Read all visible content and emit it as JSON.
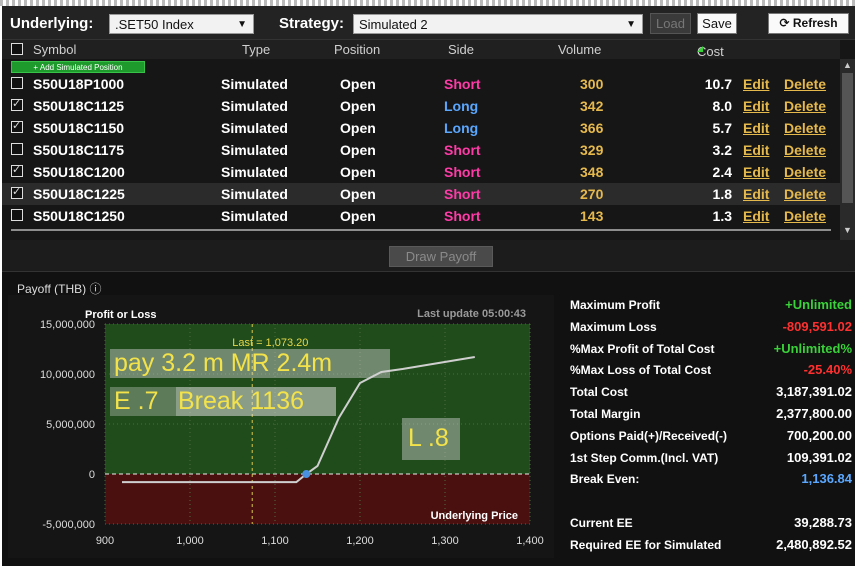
{
  "toolbar": {
    "underlying_label": "Underlying:",
    "underlying_value": ".SET50 Index",
    "strategy_label": "Strategy:",
    "strategy_value": "Simulated 2",
    "load_label": "Load",
    "save_label": "Save",
    "refresh_label": "Refresh",
    "refresh_icon": "refresh-icon"
  },
  "grid": {
    "headers": {
      "symbol": "Symbol",
      "type": "Type",
      "position": "Position",
      "side": "Side",
      "volume": "Volume",
      "cost": "Cost"
    },
    "add_label": "+ Add Simulated Position",
    "rows": [
      {
        "checked": false,
        "symbol": "S50U18P1000",
        "type": "Simulated",
        "position": "Open",
        "side": "Short",
        "volume": "300",
        "cost": "10.7",
        "edit": "Edit",
        "delete": "Delete"
      },
      {
        "checked": true,
        "symbol": "S50U18C1125",
        "type": "Simulated",
        "position": "Open",
        "side": "Long",
        "volume": "342",
        "cost": "8.0",
        "edit": "Edit",
        "delete": "Delete"
      },
      {
        "checked": true,
        "symbol": "S50U18C1150",
        "type": "Simulated",
        "position": "Open",
        "side": "Long",
        "volume": "366",
        "cost": "5.7",
        "edit": "Edit",
        "delete": "Delete"
      },
      {
        "checked": false,
        "symbol": "S50U18C1175",
        "type": "Simulated",
        "position": "Open",
        "side": "Short",
        "volume": "329",
        "cost": "3.2",
        "edit": "Edit",
        "delete": "Delete"
      },
      {
        "checked": true,
        "symbol": "S50U18C1200",
        "type": "Simulated",
        "position": "Open",
        "side": "Short",
        "volume": "348",
        "cost": "2.4",
        "edit": "Edit",
        "delete": "Delete"
      },
      {
        "checked": true,
        "symbol": "S50U18C1225",
        "type": "Simulated",
        "position": "Open",
        "side": "Short",
        "volume": "270",
        "cost": "1.8",
        "edit": "Edit",
        "delete": "Delete",
        "selected": true
      },
      {
        "checked": false,
        "symbol": "S50U18C1250",
        "type": "Simulated",
        "position": "Open",
        "side": "Short",
        "volume": "143",
        "cost": "1.3",
        "edit": "Edit",
        "delete": "Delete"
      }
    ]
  },
  "draw_payoff_label": "Draw Payoff",
  "payoff": {
    "title": "Payoff (THB)",
    "info_icon": "info-icon",
    "chart_title": "Profit or Loss",
    "last_update": "Last update 05:00:43",
    "last_label": "Last = 1,073.20",
    "x_axis_label": "Underlying Price"
  },
  "overlays": {
    "line1": "pay 3.2 m MR 2.4m",
    "line2_e": "E .7",
    "line2_break": "Break 1136",
    "line3": "L .8"
  },
  "chart_data": {
    "type": "line",
    "title": "Profit or Loss",
    "xlabel": "Underlying Price",
    "ylabel": "",
    "xlim": [
      900,
      1400
    ],
    "ylim": [
      -5000000,
      15000000
    ],
    "x_ticks": [
      "900",
      "1,000",
      "1,100",
      "1,200",
      "1,300",
      "1,400"
    ],
    "y_ticks": [
      "15,000,000",
      "10,000,000",
      "5,000,000",
      "0",
      "-5,000,000"
    ],
    "y_tick_values": [
      15000000,
      10000000,
      5000000,
      0,
      -5000000
    ],
    "x_tick_values": [
      900,
      1000,
      1100,
      1200,
      1300,
      1400
    ],
    "last_price": 1073.2,
    "break_even": 1136.84,
    "series": [
      {
        "x": [
          920,
          1125,
          1136.84,
          1150,
          1175,
          1200,
          1225,
          1250,
          1335
        ],
        "y": [
          -809591,
          -809591,
          0,
          800000,
          5600000,
          9100000,
          10200000,
          10500000,
          11700000
        ]
      }
    ],
    "grid": true,
    "colors": {
      "profit_zone": "#1f4c1a",
      "loss_zone": "#4a1010",
      "line": "#cfcfcf",
      "marker": "#4a90e2"
    }
  },
  "stats": [
    {
      "key": "Maximum Profit",
      "value": "+Unlimited",
      "color": "green"
    },
    {
      "key": "Maximum Loss",
      "value": "-809,591.02",
      "color": "red"
    },
    {
      "key": "%Max Profit of Total Cost",
      "value": "+Unlimited%",
      "color": "green"
    },
    {
      "key": "%Max Loss of Total Cost",
      "value": "-25.40%",
      "color": "red"
    },
    {
      "key": "Total Cost",
      "value": "3,187,391.02",
      "color": ""
    },
    {
      "key": "Total Margin",
      "value": "2,377,800.00",
      "color": ""
    },
    {
      "key": "Options Paid(+)/Received(-)",
      "value": "700,200.00",
      "color": ""
    },
    {
      "key": "1st Step Comm.(Incl. VAT)",
      "value": "109,391.02",
      "color": ""
    },
    {
      "key": "Break Even:",
      "value": "1,136.84",
      "color": "blue"
    },
    {
      "key": "Current EE",
      "value": "39,288.73",
      "color": ""
    },
    {
      "key": "Required EE for Simulated",
      "value": "2,480,892.52",
      "color": ""
    }
  ]
}
